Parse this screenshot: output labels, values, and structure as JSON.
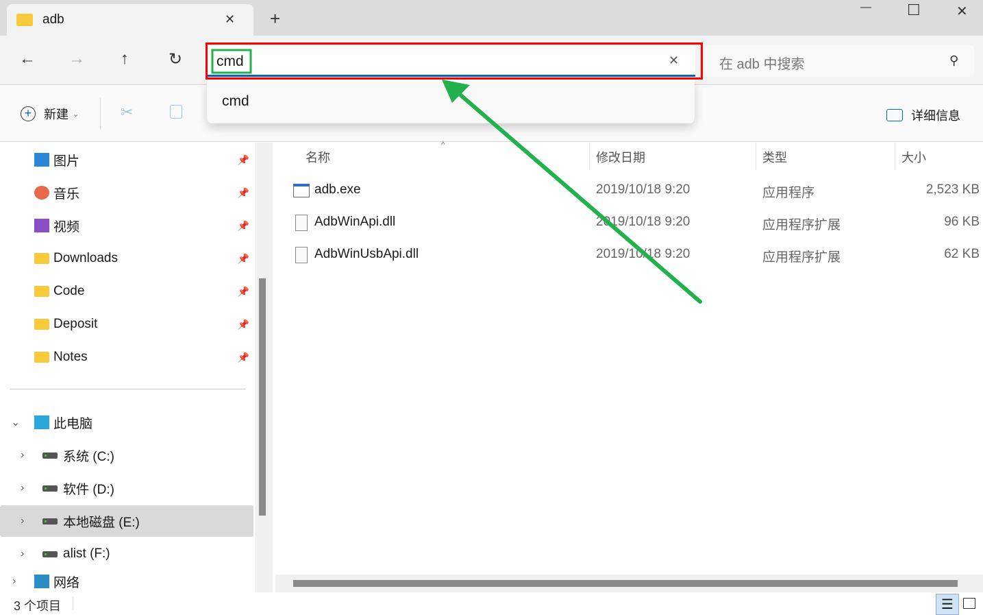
{
  "window": {
    "tab_title": "adb",
    "new_tab": "+",
    "minimize": "—",
    "maximize": "☐",
    "close": "✕",
    "tab_close": "✕"
  },
  "nav": {
    "back": "←",
    "forward": "→",
    "up": "↑",
    "refresh": "↻"
  },
  "address": {
    "value": "cmd",
    "clear": "✕",
    "suggestion": "cmd"
  },
  "search": {
    "placeholder": "在 adb 中搜索"
  },
  "commandbar": {
    "new_label": "新建",
    "details_label": "详细信息"
  },
  "sidebar": {
    "quick": [
      {
        "label": "图片",
        "icon": "pictures-icon"
      },
      {
        "label": "音乐",
        "icon": "music-icon"
      },
      {
        "label": "视频",
        "icon": "video-icon"
      },
      {
        "label": "Downloads",
        "icon": "folder-icon"
      },
      {
        "label": "Code",
        "icon": "folder-icon"
      },
      {
        "label": "Deposit",
        "icon": "folder-icon"
      },
      {
        "label": "Notes",
        "icon": "folder-icon"
      }
    ],
    "this_pc": "此电脑",
    "drives": [
      {
        "label": "系统 (C:)"
      },
      {
        "label": "软件 (D:)"
      },
      {
        "label": "本地磁盘 (E:)",
        "selected": true
      },
      {
        "label": "alist (F:)"
      }
    ],
    "network": "网络"
  },
  "columns": [
    "名称",
    "修改日期",
    "类型",
    "大小"
  ],
  "files": [
    {
      "name": "adb.exe",
      "date": "2019/10/18 9:20",
      "type": "应用程序",
      "size": "2,523 KB"
    },
    {
      "name": "AdbWinApi.dll",
      "date": "2019/10/18 9:20",
      "type": "应用程序扩展",
      "size": "96 KB"
    },
    {
      "name": "AdbWinUsbApi.dll",
      "date": "2019/10/18 9:20",
      "type": "应用程序扩展",
      "size": "62 KB"
    }
  ],
  "status": {
    "count": "3 个项目"
  },
  "colors": {
    "annotation_red": "#ff0000",
    "annotation_green": "#22b14c",
    "accent": "#0067c0"
  }
}
